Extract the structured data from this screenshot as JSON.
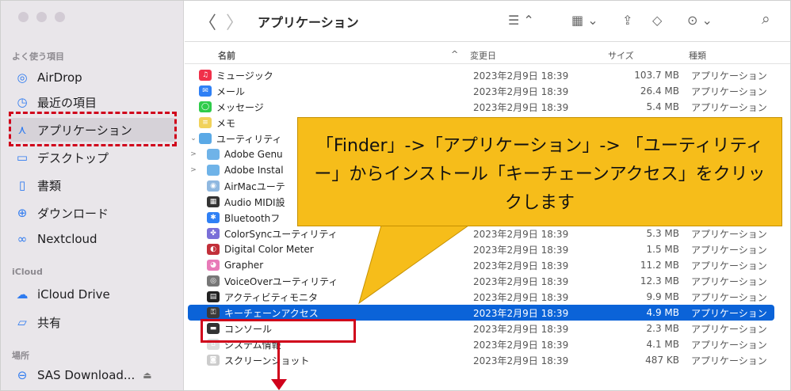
{
  "window": {
    "title": "アプリケーション"
  },
  "sidebar": {
    "favorites_title": "よく使う項目",
    "icloud_title": "iCloud",
    "locations_title": "場所",
    "items": [
      {
        "label": "AirDrop",
        "icon": "airdrop-icon",
        "glyph": "◎"
      },
      {
        "label": "最近の項目",
        "icon": "clock-icon",
        "glyph": "◷"
      },
      {
        "label": "アプリケーション",
        "icon": "applications-icon",
        "glyph": "⋏",
        "active": true
      },
      {
        "label": "デスクトップ",
        "icon": "desktop-icon",
        "glyph": "▭"
      },
      {
        "label": "書類",
        "icon": "document-icon",
        "glyph": "▯"
      },
      {
        "label": "ダウンロード",
        "icon": "download-icon",
        "glyph": "⊕"
      },
      {
        "label": "Nextcloud",
        "icon": "nextcloud-icon",
        "glyph": "∞"
      },
      {
        "label": "iCloud Drive",
        "icon": "cloud-icon",
        "glyph": "☁"
      },
      {
        "label": "共有",
        "icon": "shared-folder-icon",
        "glyph": "▱"
      },
      {
        "label": "SAS Download...",
        "icon": "drive-icon",
        "glyph": "⊖",
        "eject": "⏏"
      }
    ]
  },
  "toolbar": {
    "back": "〈",
    "forward": "〉",
    "view_icon": "☰ ⌃",
    "group_icon": "▦ ⌄",
    "share_icon": "⇪",
    "tag_icon": "◇",
    "more_icon": "⊙ ⌄",
    "search_icon": "⌕"
  },
  "columns": {
    "name": "名前",
    "date": "変更日",
    "size": "サイズ",
    "kind": "種類",
    "sort_indicator": "^"
  },
  "rows": [
    {
      "name": "ミュージック",
      "date": "2023年2月9日 18:39",
      "size": "103.7 MB",
      "kind": "アプリケーション",
      "color": "#f0304a",
      "glyph": "♫"
    },
    {
      "name": "メール",
      "date": "2023年2月9日 18:39",
      "size": "26.4 MB",
      "kind": "アプリケーション",
      "color": "#2f80f5",
      "glyph": "✉"
    },
    {
      "name": "メッセージ",
      "date": "2023年2月9日 18:39",
      "size": "5.4 MB",
      "kind": "アプリケーション",
      "color": "#2fcc4a",
      "glyph": "◯"
    },
    {
      "name": "メモ",
      "date": "",
      "size": "",
      "kind": "",
      "color": "#f1d25a",
      "glyph": "≡"
    },
    {
      "name": "ユーティリティ",
      "date": "",
      "size": "",
      "kind": "",
      "color": "#5aa9e6",
      "glyph": "",
      "disclosure": "⌄"
    },
    {
      "name": "Adobe Genu",
      "date": "",
      "size": "",
      "kind": "",
      "color": "#6fb3e8",
      "glyph": "",
      "disclosure": ">",
      "indent": true
    },
    {
      "name": "Adobe Instal",
      "date": "",
      "size": "",
      "kind": "",
      "color": "#6fb3e8",
      "glyph": "",
      "disclosure": ">",
      "indent": true
    },
    {
      "name": "AirMacユーテ",
      "date": "",
      "size": "",
      "kind": "",
      "color": "#8fb8e0",
      "glyph": "◉",
      "indent": true
    },
    {
      "name": "Audio MIDI設",
      "date": "",
      "size": "",
      "kind": "",
      "color": "#333333",
      "glyph": "▦",
      "indent": true
    },
    {
      "name": "Bluetoothフ",
      "date": "",
      "size": "",
      "kind": "",
      "color": "#2f80f5",
      "glyph": "✱",
      "indent": true
    },
    {
      "name": "ColorSyncユーティリティ",
      "date": "2023年2月9日 18:39",
      "size": "5.3 MB",
      "kind": "アプリケーション",
      "color": "#7a6fd8",
      "glyph": "✤",
      "indent": true
    },
    {
      "name": "Digital Color Meter",
      "date": "2023年2月9日 18:39",
      "size": "1.5 MB",
      "kind": "アプリケーション",
      "color": "#c2303a",
      "glyph": "◐",
      "indent": true
    },
    {
      "name": "Grapher",
      "date": "2023年2月9日 18:39",
      "size": "11.2 MB",
      "kind": "アプリケーション",
      "color": "#e87ab8",
      "glyph": "◕",
      "indent": true
    },
    {
      "name": "VoiceOverユーティリティ",
      "date": "2023年2月9日 18:39",
      "size": "12.3 MB",
      "kind": "アプリケーション",
      "color": "#777777",
      "glyph": "◎",
      "indent": true
    },
    {
      "name": "アクティビティモニタ",
      "date": "2023年2月9日 18:39",
      "size": "9.9 MB",
      "kind": "アプリケーション",
      "color": "#222222",
      "glyph": "▤",
      "indent": true
    },
    {
      "name": "キーチェーンアクセス",
      "date": "2023年2月9日 18:39",
      "size": "4.9 MB",
      "kind": "アプリケーション",
      "color": "#3a3a3a",
      "glyph": "⚿",
      "indent": true,
      "selected": true
    },
    {
      "name": "コンソール",
      "date": "2023年2月9日 18:39",
      "size": "2.3 MB",
      "kind": "アプリケーション",
      "color": "#333333",
      "glyph": "▬",
      "indent": true
    },
    {
      "name": "システム情報",
      "date": "2023年2月9日 18:39",
      "size": "4.1 MB",
      "kind": "アプリケーション",
      "color": "#dddddd",
      "glyph": "⌂",
      "indent": true
    },
    {
      "name": "スクリーンショット",
      "date": "2023年2月9日 18:39",
      "size": "487 KB",
      "kind": "アプリケーション",
      "color": "#cccccc",
      "glyph": "◙",
      "indent": true
    }
  ],
  "annotation": {
    "callout_text": "「Finder」->「アプリケーション」-> 「ユーティリティー」からインストール「キーチェーンアクセス」をクリックします",
    "highlight_color": "#d0021b",
    "callout_color": "#f6bd1a"
  }
}
